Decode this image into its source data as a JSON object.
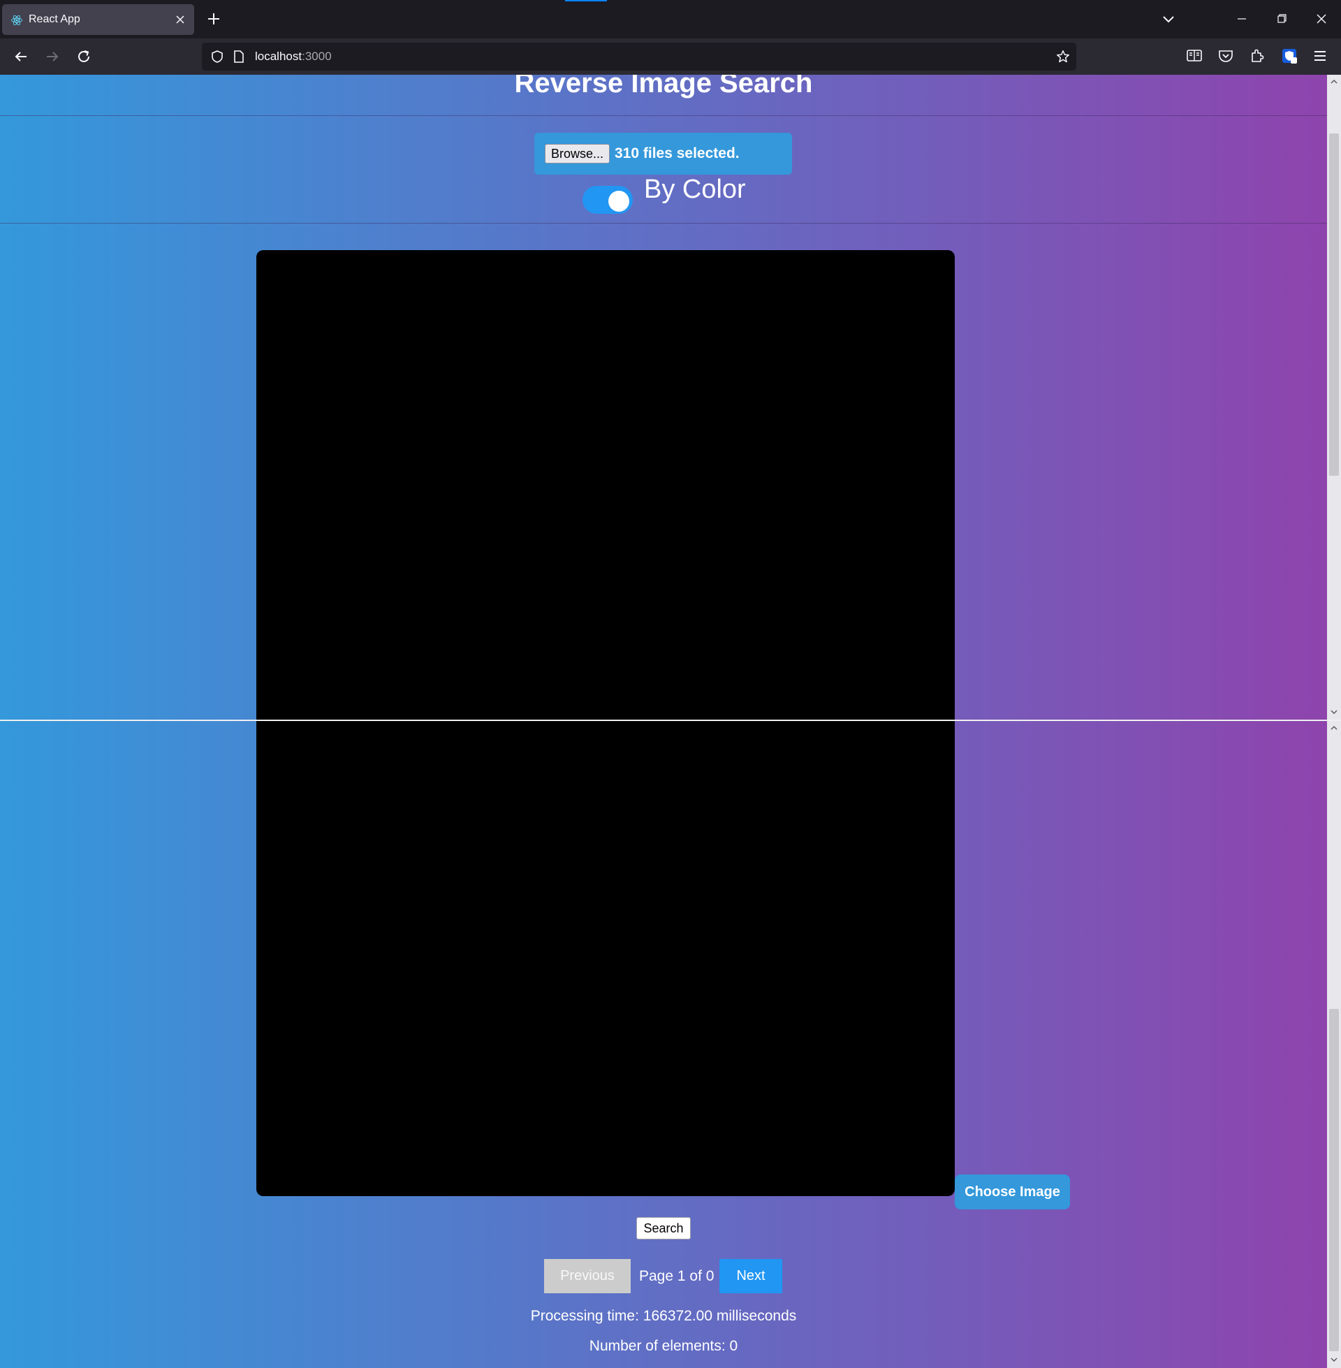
{
  "browser": {
    "tab_title": "React App",
    "url_host": "localhost",
    "url_port": ":3000"
  },
  "app": {
    "title": "Reverse Image Search",
    "upload": {
      "browse_label": "Browse...",
      "files_status": "310 files selected."
    },
    "toggle": {
      "label": "By Color",
      "checked": true
    },
    "choose_image_label": "Choose Image",
    "search_label": "Search",
    "pagination": {
      "previous_label": "Previous",
      "page_info": "Page 1 of 0",
      "next_label": "Next"
    },
    "processing_time": "Processing time: 166372.00 milliseconds",
    "number_of_elements": "Number of elements: 0"
  },
  "colors": {
    "gradient_start": "#3498db",
    "gradient_end": "#8e44ad",
    "toggle_on": "#2196f3",
    "next_button": "#2196f3",
    "previous_disabled": "#cccccc"
  },
  "icons": [
    "react-favicon",
    "close-icon",
    "plus-icon",
    "chevron-down-icon",
    "minimize-icon",
    "restore-icon",
    "back-arrow-icon",
    "forward-arrow-icon",
    "reload-icon",
    "shield-icon",
    "page-icon",
    "star-icon",
    "reader-view-icon",
    "pocket-icon",
    "extensions-icon",
    "extension-badge-icon",
    "hamburger-menu-icon"
  ]
}
